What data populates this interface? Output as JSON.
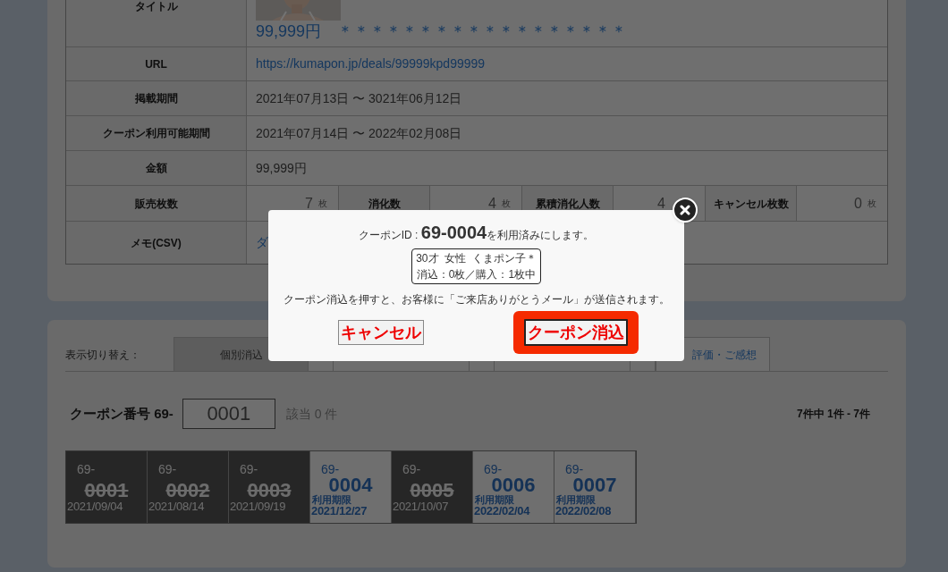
{
  "detail_table": {
    "title_row": {
      "label": "タイトル",
      "kind": "picture",
      "title": "99,999円　＊＊＊＊＊＊＊＊＊＊＊＊＊＊＊＊＊＊"
    },
    "rows": [
      {
        "label": "URL",
        "value": "https://kumapon.jp/deals/99999kpd99999",
        "link": true
      },
      {
        "label": "掲載期間",
        "value": "2021年07月13日 〜 3021年06月12日",
        "link": false
      },
      {
        "label": "クーポン利用可能期間",
        "value": "2021年07月14日 〜 2022年02月08日",
        "link": false
      },
      {
        "label": "金額",
        "value": "99,999円",
        "link": false
      }
    ],
    "counts": [
      {
        "label": "販売枚数",
        "value": "7",
        "unit": "枚"
      },
      {
        "label": "消化数",
        "value": "4",
        "unit": "枚"
      },
      {
        "label": "累積消化人数",
        "value": "4"
      },
      {
        "label": "キャンセル枚数",
        "value": "0",
        "unit": "枚"
      }
    ],
    "memo": {
      "label": "メモ(CSV)",
      "value": "ダ"
    }
  },
  "view_switch": {
    "label": "表示切り替え：",
    "tabs": [
      {
        "label": "個別消込",
        "selected": true
      },
      {
        "label": "評価・ご感想",
        "selected": false
      }
    ]
  },
  "search": {
    "label": "クーポン番号 69-",
    "value": "0001",
    "hits": "該当 0 件",
    "range": "7件中 1件 - 7件"
  },
  "coupons": [
    {
      "kind": "used",
      "prefix": "69-",
      "number": "0001",
      "date": "2021/09/04"
    },
    {
      "kind": "used",
      "prefix": "69-",
      "number": "0002",
      "date": "2021/08/14"
    },
    {
      "kind": "used",
      "prefix": "69-",
      "number": "0003",
      "date": "2021/09/19"
    },
    {
      "kind": "open",
      "prefix": "69-",
      "number": "0004",
      "limit": "利用期限",
      "date": "2021/12/27"
    },
    {
      "kind": "used",
      "prefix": "69-",
      "number": "0005",
      "date": "2021/10/07"
    },
    {
      "kind": "open",
      "prefix": "69-",
      "number": "0006",
      "limit": "利用期限",
      "date": "2022/02/04"
    },
    {
      "kind": "open",
      "prefix": "69-",
      "number": "0007",
      "limit": "利用期限",
      "date": "2022/02/08"
    }
  ],
  "dialog": {
    "message": "クーポンID : **69-0004**を利用済みにします。",
    "customer": [
      "30才  女性  くまポン子＊",
      "消込：0枚／購入：1枚中"
    ],
    "notice": "クーポン消込を押すと、お客様に「ご来店ありがとうメール」が送信されます。",
    "buttons": [
      {
        "label": "キャンセル",
        "highlighted": false
      },
      {
        "label": "クーポン消込",
        "highlighted": true
      }
    ]
  }
}
